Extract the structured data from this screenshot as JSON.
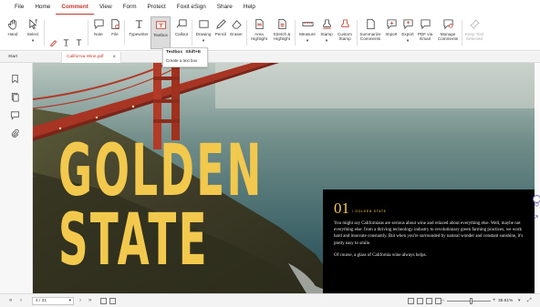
{
  "menu": [
    "File",
    "Home",
    "Comment",
    "View",
    "Form",
    "Protect",
    "Foxit eSign",
    "Share",
    "Help"
  ],
  "active_menu": "Comment",
  "ribbon": {
    "hand": "Hand",
    "select": "Select",
    "note": "Note",
    "file": "File",
    "typewriter": "Typewriter",
    "textbox": "Textbox",
    "callout": "Callout",
    "drawing": "Drawing",
    "pencil": "Pencil",
    "eraser": "Eraser",
    "area_highlight": [
      "Area",
      "Highlight"
    ],
    "stretch_highlight": [
      "Stretch &",
      "Highlight"
    ],
    "measure": "Measure",
    "stamp": "Stamp",
    "custom_stamp": [
      "Custom",
      "Stamp"
    ],
    "summarize": [
      "Summarize",
      "Comments"
    ],
    "import": "Import",
    "export": "Export",
    "pdf_via_email": [
      "PDF via",
      "Email"
    ],
    "manage_comments": [
      "Manage",
      "Comments"
    ],
    "keep_tool_selected": [
      "Keep Tool",
      "Selected"
    ]
  },
  "tooltip": {
    "title": "Textbox",
    "shortcut": "Shift+E",
    "description": "Create a text box"
  },
  "tabs": {
    "start": "Start",
    "document": "California Wine.pdf"
  },
  "document": {
    "headline_line1": "GOLDEN",
    "headline_line2": "STATE",
    "section_number": "01",
    "section_subtitle": "/ GOLDEN STATE",
    "paragraph1": "You might say Californians are serious about wine and relaxed about everything else. Well, maybe not everything else: from a thriving technology industry to revolutionary green farming practices, we work hard and innovate constantly. But when you're surrounded by natural wonder and constant sunshine, it's pretty easy to smile.",
    "paragraph2": "Of course, a glass of California wine always helps."
  },
  "status": {
    "page": "4 / 31",
    "zoom": "38.61%",
    "zoom_fraction": 0.55
  },
  "colors": {
    "accent": "#c0392b",
    "headline": "#f2c94c",
    "bridge": "#c0392b"
  }
}
